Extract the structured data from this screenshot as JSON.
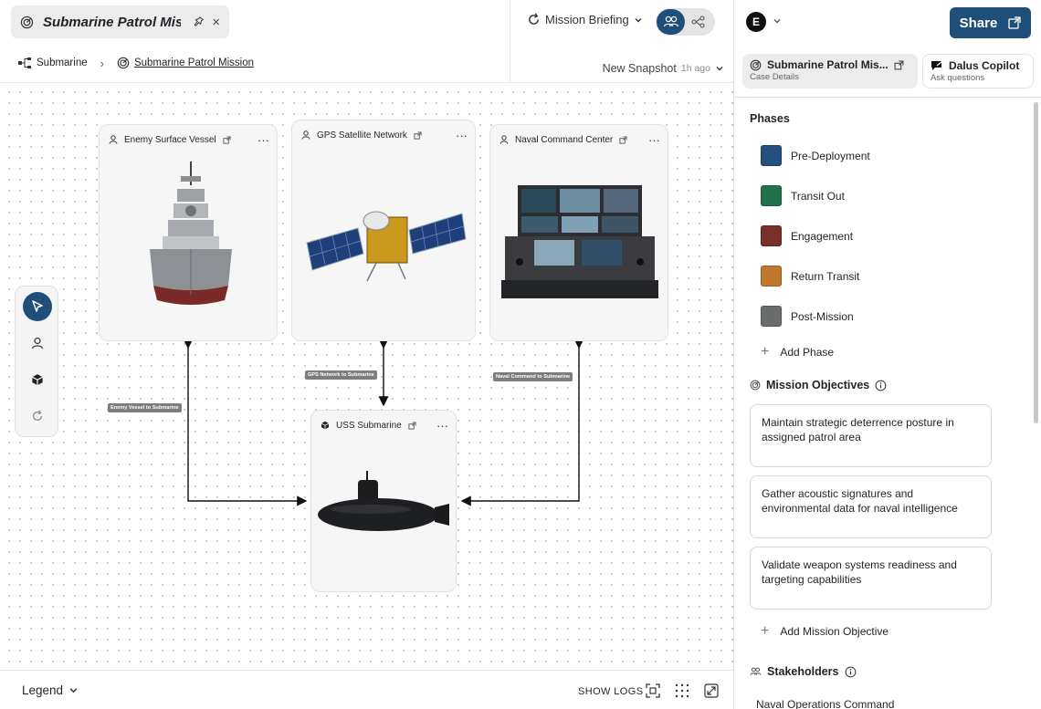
{
  "tab": {
    "title": "Submarine Patrol Mis...",
    "pin_icon": "pin-icon",
    "close_label": "×"
  },
  "breadcrumb": {
    "root": "Submarine",
    "current": "Submarine Patrol Mission"
  },
  "toolbar": {
    "mission_briefing": "Mission Briefing",
    "snapshot_label": "New Snapshot",
    "snapshot_age": "1h ago"
  },
  "canvas": {
    "nodes": [
      {
        "label": "Enemy Surface Vessel",
        "kind": "actor"
      },
      {
        "label": "GPS Satellite Network",
        "kind": "actor"
      },
      {
        "label": "Naval Command Center",
        "kind": "actor"
      },
      {
        "label": "USS Submarine",
        "kind": "system"
      }
    ],
    "edges": [
      "Enemy Vessel to Submarine",
      "GPS Network to Submarine",
      "Naval Command to Submarine"
    ],
    "menu_glyph": "···"
  },
  "bottom": {
    "legend": "Legend",
    "show_logs": "SHOW LOGS"
  },
  "panel": {
    "avatar": "E",
    "share": "Share",
    "tabs": [
      {
        "title": "Submarine Patrol Mis...",
        "sub": "Case Details"
      },
      {
        "title": "Dalus Copilot",
        "sub": "Ask questions"
      }
    ],
    "phases_title": "Phases",
    "phases": [
      {
        "label": "Pre-Deployment",
        "color": "#24507f"
      },
      {
        "label": "Transit Out",
        "color": "#237148"
      },
      {
        "label": "Engagement",
        "color": "#7c2e28"
      },
      {
        "label": "Return Transit",
        "color": "#c0772b"
      },
      {
        "label": "Post-Mission",
        "color": "#6b6c6e"
      }
    ],
    "add_phase": "Add Phase",
    "objectives_title": "Mission Objectives",
    "objectives": [
      "Maintain strategic deterrence posture in assigned patrol area",
      "Gather acoustic signatures and environmental data for naval intelligence",
      "Validate weapon systems readiness and targeting capabilities"
    ],
    "add_objective": "Add Mission Objective",
    "stakeholders_title": "Stakeholders",
    "stakeholders": [
      "Naval Operations Command"
    ]
  }
}
